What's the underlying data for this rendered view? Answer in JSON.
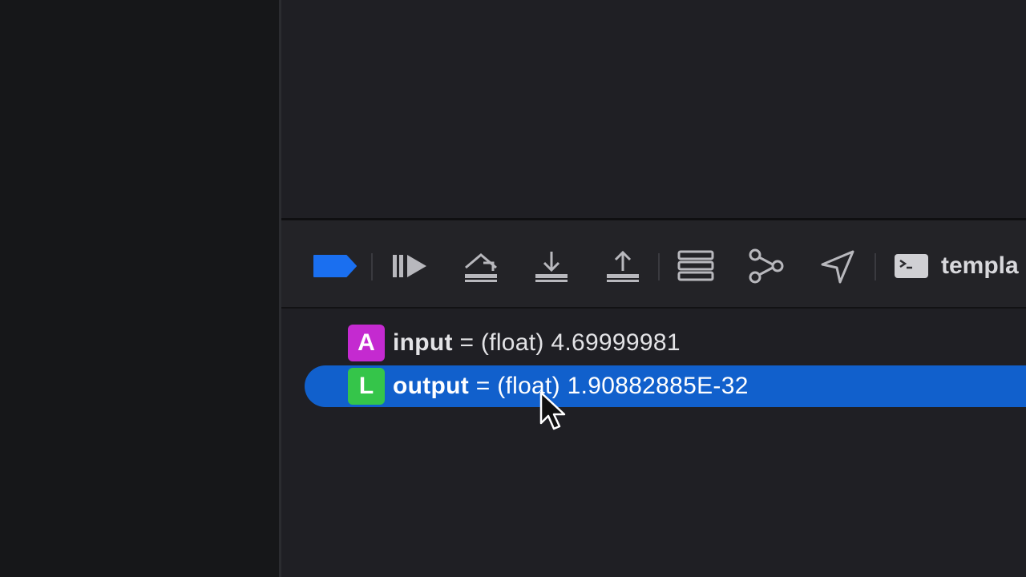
{
  "debug_toolbar": {
    "breakpoints_button": "toggle-breakpoints",
    "continue_button": "continue-icon",
    "step_over_button": "step-over-icon",
    "step_into_button": "step-into-icon",
    "step_out_button": "step-out-icon",
    "view_hierarchy_button": "view-hierarchy-icon",
    "memory_graph_button": "memory-graph-icon",
    "location_button": "location-icon",
    "target_label": "templa",
    "accent_color": "#1a6ff0"
  },
  "variables": [
    {
      "kind_letter": "A",
      "kind_color": "#c42ad0",
      "name": "input",
      "separator": " = ",
      "type": "(float)",
      "value": "4.69999981",
      "selected": false
    },
    {
      "kind_letter": "L",
      "kind_color": "#35c54a",
      "name": "output",
      "separator": " = ",
      "type": "(float)",
      "value": "1.90882885E-32",
      "selected": true
    }
  ],
  "colors": {
    "selection": "#1160cc",
    "background": "#1f1f24"
  }
}
